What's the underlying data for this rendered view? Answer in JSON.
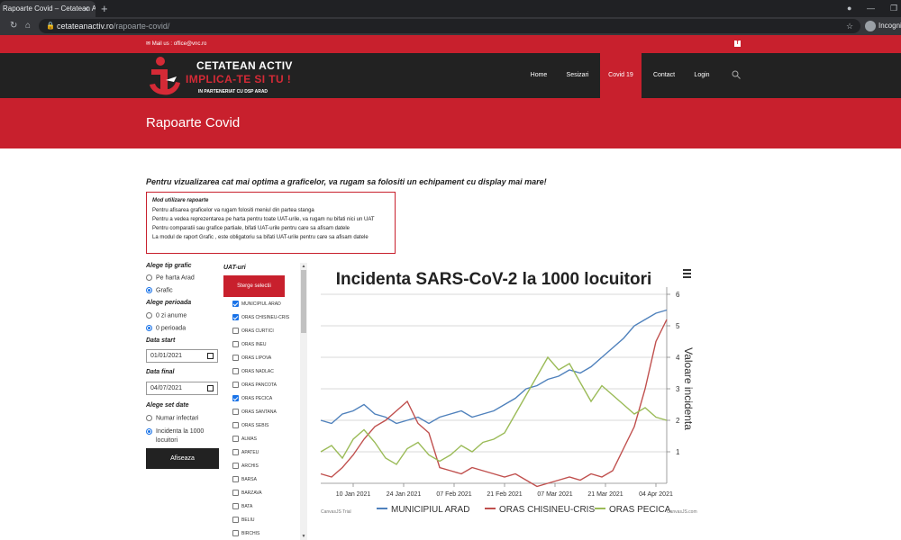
{
  "browser": {
    "tab_title": "Rapoarte Covid – Cetatean Activ",
    "url_host": "cetateanactiv.ro",
    "url_path": "/rapoarte-covid/",
    "incognito_label": "Incognito"
  },
  "site": {
    "mail": "Mail us : office@vnc.ro",
    "logo": {
      "line1": "CETATEAN ACTIV",
      "line2": "IMPLICA-TE SI TU !",
      "line3": "IN PARTENERIAT CU DSP ARAD"
    },
    "menu": [
      "Home",
      "Sesizari",
      "Covid 19",
      "Contact",
      "Login"
    ],
    "active_menu": "Covid 19",
    "hero_title": "Rapoarte Covid",
    "notice": "Pentru vizualizarea cat mai optima a graficelor, va rugam sa folositi un echipament cu display mai mare!",
    "info": {
      "title": "Mod utilizare rapoarte",
      "lines": [
        "Pentru afisarea graficelor va rugam folositi meniul din partea stanga",
        "Pentru a vedea reprezentarea pe harta pentru toate UAT-urile, va rugam nu bifati nici un UAT",
        "Pentru comparatii sau grafice partiale, bifati UAT-urile pentru care sa afisam datele",
        "La modul de raport Grafic , este obligatoriu sa bifati UAT-urile pentru care sa afisam datele"
      ]
    }
  },
  "controls": {
    "tip_label": "Alege tip grafic",
    "tip_options": [
      "Pe harta Arad",
      "Grafic"
    ],
    "tip_selected": 1,
    "perioada_label": "Alege perioada",
    "perioada_options": [
      "0 zi anume",
      "0 perioada"
    ],
    "perioada_selected": 1,
    "start_label": "Data start",
    "start_value": "01/01/2021",
    "final_label": "Data final",
    "final_value": "04/07/2021",
    "set_label": "Alege set date",
    "set_options": [
      "Numar infectari",
      "Incidenta la 1000 locuitori"
    ],
    "set_selected": 1,
    "submit": "Afiseaza"
  },
  "uat": {
    "title": "UAT-uri",
    "clear": "Sterge selectii",
    "items": [
      {
        "name": "MUNICIPIUL ARAD",
        "checked": true
      },
      {
        "name": "ORAS CHISINEU-CRIS",
        "checked": true
      },
      {
        "name": "ORAS CURTICI",
        "checked": false
      },
      {
        "name": "ORAS INEU",
        "checked": false
      },
      {
        "name": "ORAS LIPOVA",
        "checked": false
      },
      {
        "name": "ORAS NADLAC",
        "checked": false
      },
      {
        "name": "ORAS PANCOTA",
        "checked": false
      },
      {
        "name": "ORAS PECICA",
        "checked": true
      },
      {
        "name": "ORAS SANTANA",
        "checked": false
      },
      {
        "name": "ORAS SEBIS",
        "checked": false
      },
      {
        "name": "ALMAS",
        "checked": false
      },
      {
        "name": "APATEU",
        "checked": false
      },
      {
        "name": "ARCHIS",
        "checked": false
      },
      {
        "name": "BARSA",
        "checked": false
      },
      {
        "name": "BARZAVA",
        "checked": false
      },
      {
        "name": "BATA",
        "checked": false
      },
      {
        "name": "BELIU",
        "checked": false
      },
      {
        "name": "BIRCHIS",
        "checked": false
      }
    ]
  },
  "chart_data": {
    "type": "line",
    "title": "Incidenta SARS-CoV-2 la 1000 locuitori",
    "ylabel": "Valoare incidenta",
    "ylim": [
      0,
      6
    ],
    "yticks": [
      1,
      2,
      3,
      4,
      5,
      6
    ],
    "xlim": [
      "2021-01-01",
      "2021-04-07"
    ],
    "xticks": [
      "10 Jan 2021",
      "24 Jan 2021",
      "07 Feb 2021",
      "21 Feb 2021",
      "07 Mar 2021",
      "21 Mar 2021",
      "04 Apr 2021"
    ],
    "xtick_dates": [
      "2021-01-10",
      "2021-01-24",
      "2021-02-07",
      "2021-02-21",
      "2021-03-07",
      "2021-03-21",
      "2021-04-04"
    ],
    "grid": true,
    "legend": "bottom",
    "credit_left": "CanvasJS Trial",
    "credit_right": "CanvasJS.com",
    "series": [
      {
        "name": "MUNICIPIUL ARAD",
        "color": "#4f81bc",
        "x": [
          "2021-01-01",
          "2021-01-04",
          "2021-01-07",
          "2021-01-10",
          "2021-01-13",
          "2021-01-16",
          "2021-01-19",
          "2021-01-22",
          "2021-01-25",
          "2021-01-28",
          "2021-01-31",
          "2021-02-03",
          "2021-02-06",
          "2021-02-09",
          "2021-02-12",
          "2021-02-15",
          "2021-02-18",
          "2021-02-21",
          "2021-02-24",
          "2021-02-27",
          "2021-03-02",
          "2021-03-05",
          "2021-03-08",
          "2021-03-11",
          "2021-03-14",
          "2021-03-17",
          "2021-03-20",
          "2021-03-23",
          "2021-03-26",
          "2021-03-29",
          "2021-04-01",
          "2021-04-04",
          "2021-04-07"
        ],
        "values": [
          2.0,
          1.9,
          2.2,
          2.3,
          2.5,
          2.2,
          2.1,
          1.9,
          2.0,
          2.1,
          1.9,
          2.1,
          2.2,
          2.3,
          2.1,
          2.2,
          2.3,
          2.5,
          2.7,
          3.0,
          3.1,
          3.3,
          3.4,
          3.6,
          3.5,
          3.7,
          4.0,
          4.3,
          4.6,
          5.0,
          5.2,
          5.4,
          5.5
        ]
      },
      {
        "name": "ORAS CHISINEU-CRIS",
        "color": "#c0504e",
        "x": [
          "2021-01-01",
          "2021-01-04",
          "2021-01-07",
          "2021-01-10",
          "2021-01-13",
          "2021-01-16",
          "2021-01-19",
          "2021-01-22",
          "2021-01-25",
          "2021-01-28",
          "2021-01-31",
          "2021-02-03",
          "2021-02-06",
          "2021-02-09",
          "2021-02-12",
          "2021-02-15",
          "2021-02-18",
          "2021-02-21",
          "2021-02-24",
          "2021-02-27",
          "2021-03-02",
          "2021-03-05",
          "2021-03-08",
          "2021-03-11",
          "2021-03-14",
          "2021-03-17",
          "2021-03-20",
          "2021-03-23",
          "2021-03-26",
          "2021-03-29",
          "2021-04-01",
          "2021-04-04",
          "2021-04-07"
        ],
        "values": [
          0.3,
          0.2,
          0.5,
          0.9,
          1.4,
          1.8,
          2.0,
          2.3,
          2.6,
          1.9,
          1.6,
          0.5,
          0.4,
          0.3,
          0.5,
          0.4,
          0.3,
          0.2,
          0.3,
          0.1,
          -0.1,
          0.0,
          0.1,
          0.2,
          0.1,
          0.3,
          0.2,
          0.4,
          1.1,
          1.8,
          3.0,
          4.5,
          5.2
        ]
      },
      {
        "name": "ORAS PECICA",
        "color": "#9bbb58",
        "x": [
          "2021-01-01",
          "2021-01-04",
          "2021-01-07",
          "2021-01-10",
          "2021-01-13",
          "2021-01-16",
          "2021-01-19",
          "2021-01-22",
          "2021-01-25",
          "2021-01-28",
          "2021-01-31",
          "2021-02-03",
          "2021-02-06",
          "2021-02-09",
          "2021-02-12",
          "2021-02-15",
          "2021-02-18",
          "2021-02-21",
          "2021-02-24",
          "2021-02-27",
          "2021-03-02",
          "2021-03-05",
          "2021-03-08",
          "2021-03-11",
          "2021-03-14",
          "2021-03-17",
          "2021-03-20",
          "2021-03-23",
          "2021-03-26",
          "2021-03-29",
          "2021-04-01",
          "2021-04-04",
          "2021-04-07"
        ],
        "values": [
          1.0,
          1.2,
          0.8,
          1.4,
          1.7,
          1.3,
          0.8,
          0.6,
          1.1,
          1.3,
          0.9,
          0.7,
          0.9,
          1.2,
          1.0,
          1.3,
          1.4,
          1.6,
          2.2,
          2.8,
          3.4,
          4.0,
          3.6,
          3.8,
          3.2,
          2.6,
          3.1,
          2.8,
          2.5,
          2.2,
          2.4,
          2.1,
          2.0
        ]
      }
    ]
  }
}
